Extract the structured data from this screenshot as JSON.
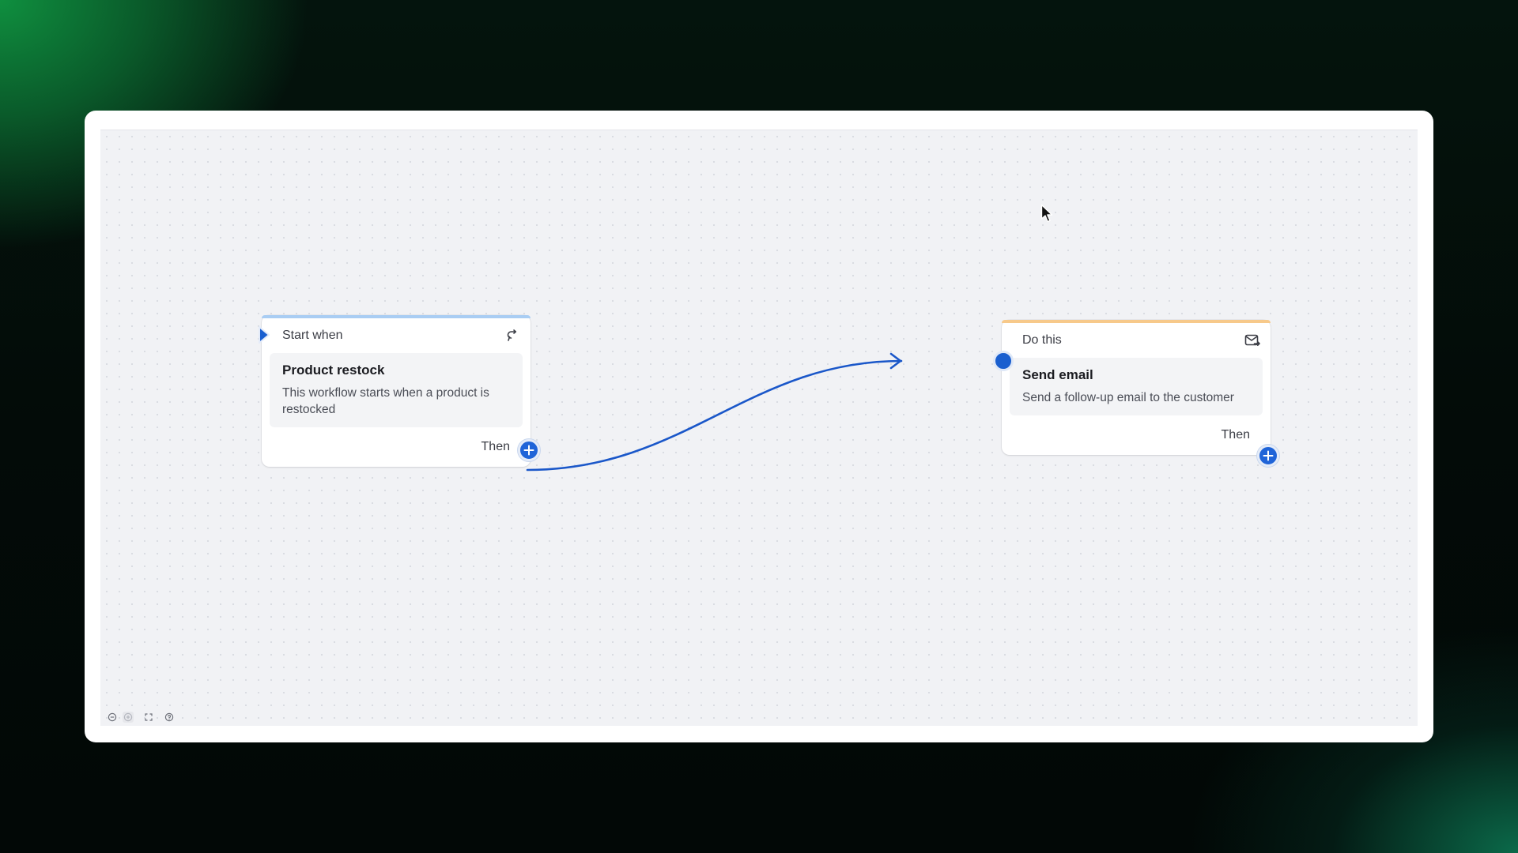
{
  "canvas": {
    "nodes": {
      "trigger": {
        "header": "Start when",
        "header_icon": "loop-arrow-icon",
        "title": "Product restock",
        "description": "This workflow starts when a product is restocked",
        "footer": "Then",
        "accent": "#a9cdf3"
      },
      "action": {
        "header": "Do this",
        "header_icon": "email-send-icon",
        "title": "Send email",
        "description": "Send a follow-up email to the customer",
        "footer": "Then",
        "accent": "#f7c98a"
      }
    },
    "connection_color": "#1a57c9",
    "controls": [
      "zoom-out-icon",
      "zoom-in-icon",
      "fit-view-icon",
      "help-icon"
    ]
  }
}
